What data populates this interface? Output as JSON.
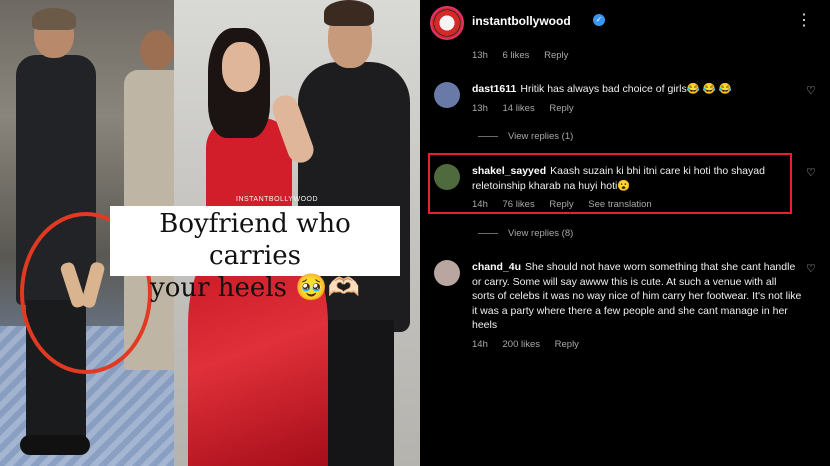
{
  "post": {
    "watermark": "INSTANTBOLLYWOOD",
    "caption_line1": "Boyfriend who carries",
    "caption_line2": "your heels 🥹🫶🏻"
  },
  "header": {
    "account": "instantbollywood",
    "verified_icon": "verified-badge-icon",
    "more_icon": "⋮"
  },
  "top_meta": {
    "time": "13h",
    "likes": "6 likes",
    "reply": "Reply"
  },
  "comments": [
    {
      "username": "dast1611",
      "text": "Hritik has always bad choice of girls😂 😂 😂",
      "time": "13h",
      "likes": "14 likes",
      "reply": "Reply",
      "view_replies": "View replies (1)",
      "avatar_color": "#6a7aa8"
    },
    {
      "username": "shakel_sayyed",
      "text": "Kaash suzain ki bhi itni care ki hoti tho shayad reletoinship kharab na huyi hoti😮",
      "time": "14h",
      "likes": "76 likes",
      "reply": "Reply",
      "translation": "See translation",
      "view_replies": "View replies (8)",
      "avatar_color": "#4f6b3e"
    },
    {
      "username": "chand_4u",
      "text": "She should not have worn something that she cant handle or carry. Some will say awww this is cute. At such a venue with all sorts of celebs it was no way nice of him carry her footwear. It's not like it was a party where there a few people and she cant manage in her heels",
      "time": "14h",
      "likes": "200 likes",
      "reply": "Reply",
      "avatar_color": "#b9a6a0"
    }
  ],
  "colors": {
    "background": "#000000",
    "highlight": "#e8202a",
    "meta_text": "#a8a8a8",
    "verified": "#3897f0"
  },
  "icons": {
    "heart": "♡"
  }
}
